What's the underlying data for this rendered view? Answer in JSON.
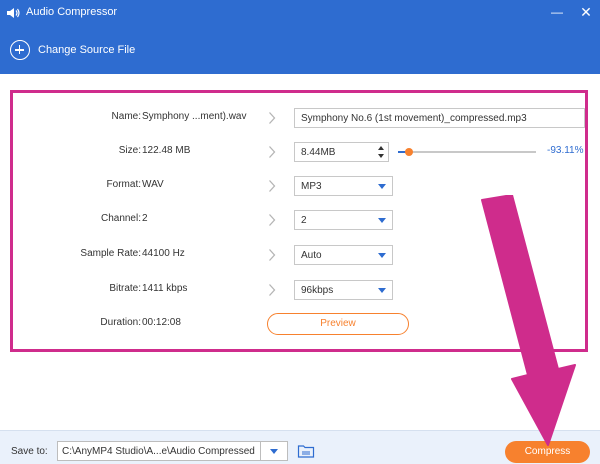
{
  "window": {
    "title": "Audio Compressor",
    "minimize_glyph": "—",
    "close_glyph": "✕"
  },
  "toolbar": {
    "change_source_label": "Change Source File"
  },
  "form": {
    "name": {
      "label": "Name:",
      "source": "Symphony ...ment).wav",
      "output": "Symphony No.6 (1st movement)_compressed.mp3"
    },
    "size": {
      "label": "Size:",
      "source": "122.48 MB",
      "output": "8.44MB",
      "percent": "-93.11%",
      "slider_fraction": 0.08
    },
    "format": {
      "label": "Format:",
      "source": "WAV",
      "selected": "MP3"
    },
    "channel": {
      "label": "Channel:",
      "source": "2",
      "selected": "2"
    },
    "sample_rate": {
      "label": "Sample Rate:",
      "source": "44100 Hz",
      "selected": "Auto"
    },
    "bitrate": {
      "label": "Bitrate:",
      "source": "1411 kbps",
      "selected": "96kbps"
    },
    "duration": {
      "label": "Duration:",
      "value": "00:12:08"
    },
    "preview_label": "Preview"
  },
  "footer": {
    "save_to_label": "Save to:",
    "save_path": "C:\\AnyMP4 Studio\\A...e\\Audio Compressed",
    "compress_label": "Compress"
  },
  "colors": {
    "accent_blue": "#2e6cd0",
    "highlight_pink": "#cf2c8c",
    "action_orange": "#f7812e"
  }
}
